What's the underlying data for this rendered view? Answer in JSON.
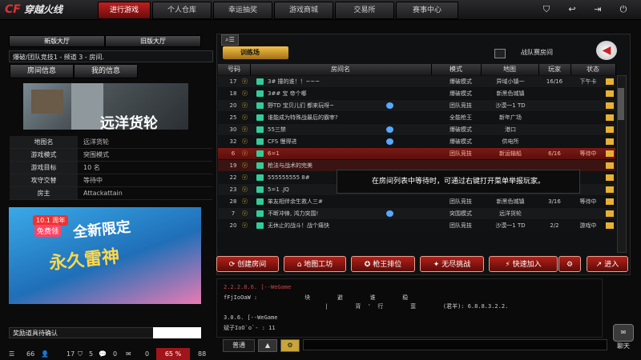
{
  "app": {
    "logo_text": "CF",
    "logo_title": "穿越火线"
  },
  "nav": {
    "tabs": [
      "进行游戏",
      "个人仓库",
      "幸运抽奖",
      "游戏商城",
      "交易所",
      "赛事中心"
    ],
    "active_index": 0,
    "icons": [
      "shield-icon",
      "back-icon",
      "exit-icon",
      "power-icon"
    ]
  },
  "left": {
    "hall_new": "新版大厅",
    "hall_old": "旧版大厅",
    "channel": "爆破/团队竞技1 - 频道 3 - 房间.",
    "tab_room_info": "房间信息",
    "tab_my_info": "我的信息",
    "map_title": "远洋货轮",
    "info": [
      {
        "label": "地图名",
        "value": "远洋货轮"
      },
      {
        "label": "游戏模式",
        "value": "突围模式"
      },
      {
        "label": "游戏目标",
        "value": "10 名"
      },
      {
        "label": "攻守交替",
        "value": "等待中"
      },
      {
        "label": "房主",
        "value": "Attackattain"
      }
    ],
    "banner": {
      "tag1": "10.1 周年",
      "tag2": "免费领",
      "line1": "全新限定",
      "line2": "永久雷神"
    },
    "notice": "奖励道具待确认"
  },
  "statusbar": {
    "a": "66",
    "b": "17",
    "c": "5",
    "d": "0",
    "e": "0",
    "fps": "65",
    "pct": "%",
    "extra": "88"
  },
  "room_list": {
    "mode_button": "训练场",
    "battle_label": "战队赛房间",
    "headers": [
      "号码",
      "房间名",
      "模式",
      "地图",
      "玩家",
      "状态"
    ],
    "rows": [
      {
        "num": "17",
        "name": "3# 撞的谁！！~~~",
        "mode": "爆破模式",
        "map": "异域小镇一",
        "players": "16/16",
        "status": "下午卡",
        "style": "odd"
      },
      {
        "num": "18",
        "name": "3## 宝  帝个哪",
        "mode": "爆破模式",
        "map": "新黑色城镇",
        "players": "",
        "status": "",
        "style": "even"
      },
      {
        "num": "20",
        "name": "野TD  宝贝儿们  都来玩呀~",
        "mode": "团队竞技",
        "map": "沙漠一1 TD",
        "players": "",
        "status": "",
        "style": "odd"
      },
      {
        "num": "25",
        "name": "谁能成为特殊战最后的霸宰?",
        "mode": "全能枪王",
        "map": "新年广场",
        "players": "",
        "status": "",
        "style": "even"
      },
      {
        "num": "30",
        "name": "55三禁",
        "mode": "爆破模式",
        "map": "港口",
        "players": "",
        "status": "",
        "style": "odd"
      },
      {
        "num": "32",
        "name": "CFS 慢得进",
        "mode": "爆破模式",
        "map": "供电所",
        "players": "",
        "status": "",
        "style": "even"
      },
      {
        "num": "6",
        "name": "6=1",
        "mode": "团队竞技",
        "map": "新运输船",
        "players": "6/16",
        "status": "等待中",
        "style": "red"
      },
      {
        "num": "19",
        "name": "枪法与战术的完美",
        "mode": "",
        "map": "",
        "players": "",
        "status": "",
        "style": "red2"
      },
      {
        "num": "22",
        "name": "555555555     8#",
        "mode": "",
        "map": "",
        "players": "",
        "status": "",
        "style": "even"
      },
      {
        "num": "23",
        "name": "5=1 .JQ",
        "mode": "团队竞技",
        "map": "新运输船",
        "players": "",
        "status": "",
        "style": "odd"
      },
      {
        "num": "28",
        "name": "笨友相伴余生救人三#",
        "mode": "团队竞技",
        "map": "新黑色城镇",
        "players": "3/16",
        "status": "等待中",
        "style": "even"
      },
      {
        "num": "7",
        "name": "不断冲锋, 鸿力突围!",
        "mode": "突围模式",
        "map": "远洋货轮",
        "players": "",
        "status": "",
        "style": "odd"
      },
      {
        "num": "20",
        "name": "无休止的战斗！战个痛快",
        "mode": "团队竞技",
        "map": "沙漠一1 TD",
        "players": "2/2",
        "status": "游戏中",
        "style": "even"
      }
    ],
    "tooltip": "在房间列表中等待时，可通过右键打开菜单举报玩家。"
  },
  "actions": [
    {
      "label": "创建房间",
      "icon": "create-room-icon"
    },
    {
      "label": "地图工坊",
      "icon": "map-workshop-icon"
    },
    {
      "label": "枪王排位",
      "icon": "ranking-icon"
    },
    {
      "label": "无尽挑战",
      "icon": "endless-icon"
    },
    {
      "label": "快速加入",
      "icon": "quick-join-icon"
    },
    {
      "label": "",
      "icon": "gear-icon"
    },
    {
      "label": "进入",
      "icon": "enter-icon"
    }
  ],
  "chat": {
    "lines": [
      "2.2.2.8.6. [--WeGame",
      "fFjIoOaW :              块        避        谁        稳",
      "                              |        背  '  行        蛮        (君羊): 6.8.8.3.2.2.",
      "",
      "3.0.6. [--WeGame",
      "斌子IoO`o`- : 11"
    ],
    "mode": "普通",
    "up": "▲",
    "setting": "⚙",
    "open_label": "聊天"
  }
}
